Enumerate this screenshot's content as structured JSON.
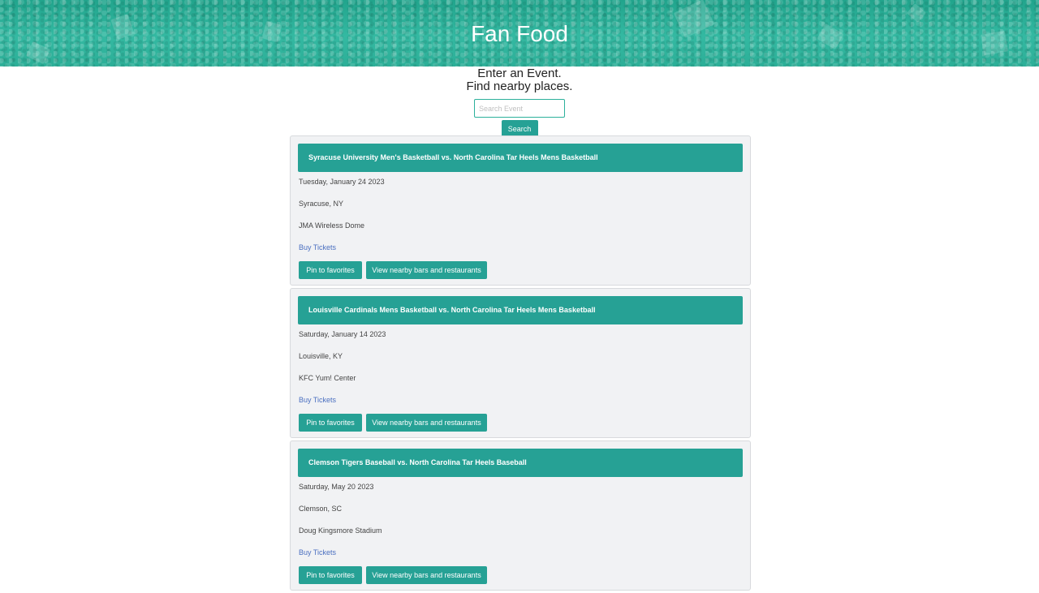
{
  "header": {
    "title": "Fan Food"
  },
  "intro": {
    "line1": "Enter an Event.",
    "line2": "Find nearby places."
  },
  "search": {
    "placeholder": "Search Event",
    "value": "",
    "button_label": "Search"
  },
  "events": [
    {
      "title": "Syracuse University Men's Basketball vs. North Carolina Tar Heels Mens Basketball",
      "date": "Tuesday, January 24 2023",
      "location": "Syracuse, NY",
      "venue": "JMA Wireless Dome",
      "tickets_label": "Buy Tickets",
      "pin_label": "Pin to favorites",
      "nearby_label": "View nearby bars and restaurants"
    },
    {
      "title": "Louisville Cardinals Mens Basketball vs. North Carolina Tar Heels Mens Basketball",
      "date": "Saturday, January 14 2023",
      "location": "Louisville, KY",
      "venue": "KFC Yum! Center",
      "tickets_label": "Buy Tickets",
      "pin_label": "Pin to favorites",
      "nearby_label": "View nearby bars and restaurants"
    },
    {
      "title": "Clemson Tigers Baseball vs. North Carolina Tar Heels Baseball",
      "date": "Saturday, May 20 2023",
      "location": "Clemson, SC",
      "venue": "Doug Kingsmore Stadium",
      "tickets_label": "Buy Tickets",
      "pin_label": "Pin to favorites",
      "nearby_label": "View nearby bars and restaurants"
    }
  ],
  "colors": {
    "accent": "#26a195",
    "hero": "#2fb39d",
    "link": "#4a6fc0",
    "card_bg": "#f1f2f4"
  }
}
